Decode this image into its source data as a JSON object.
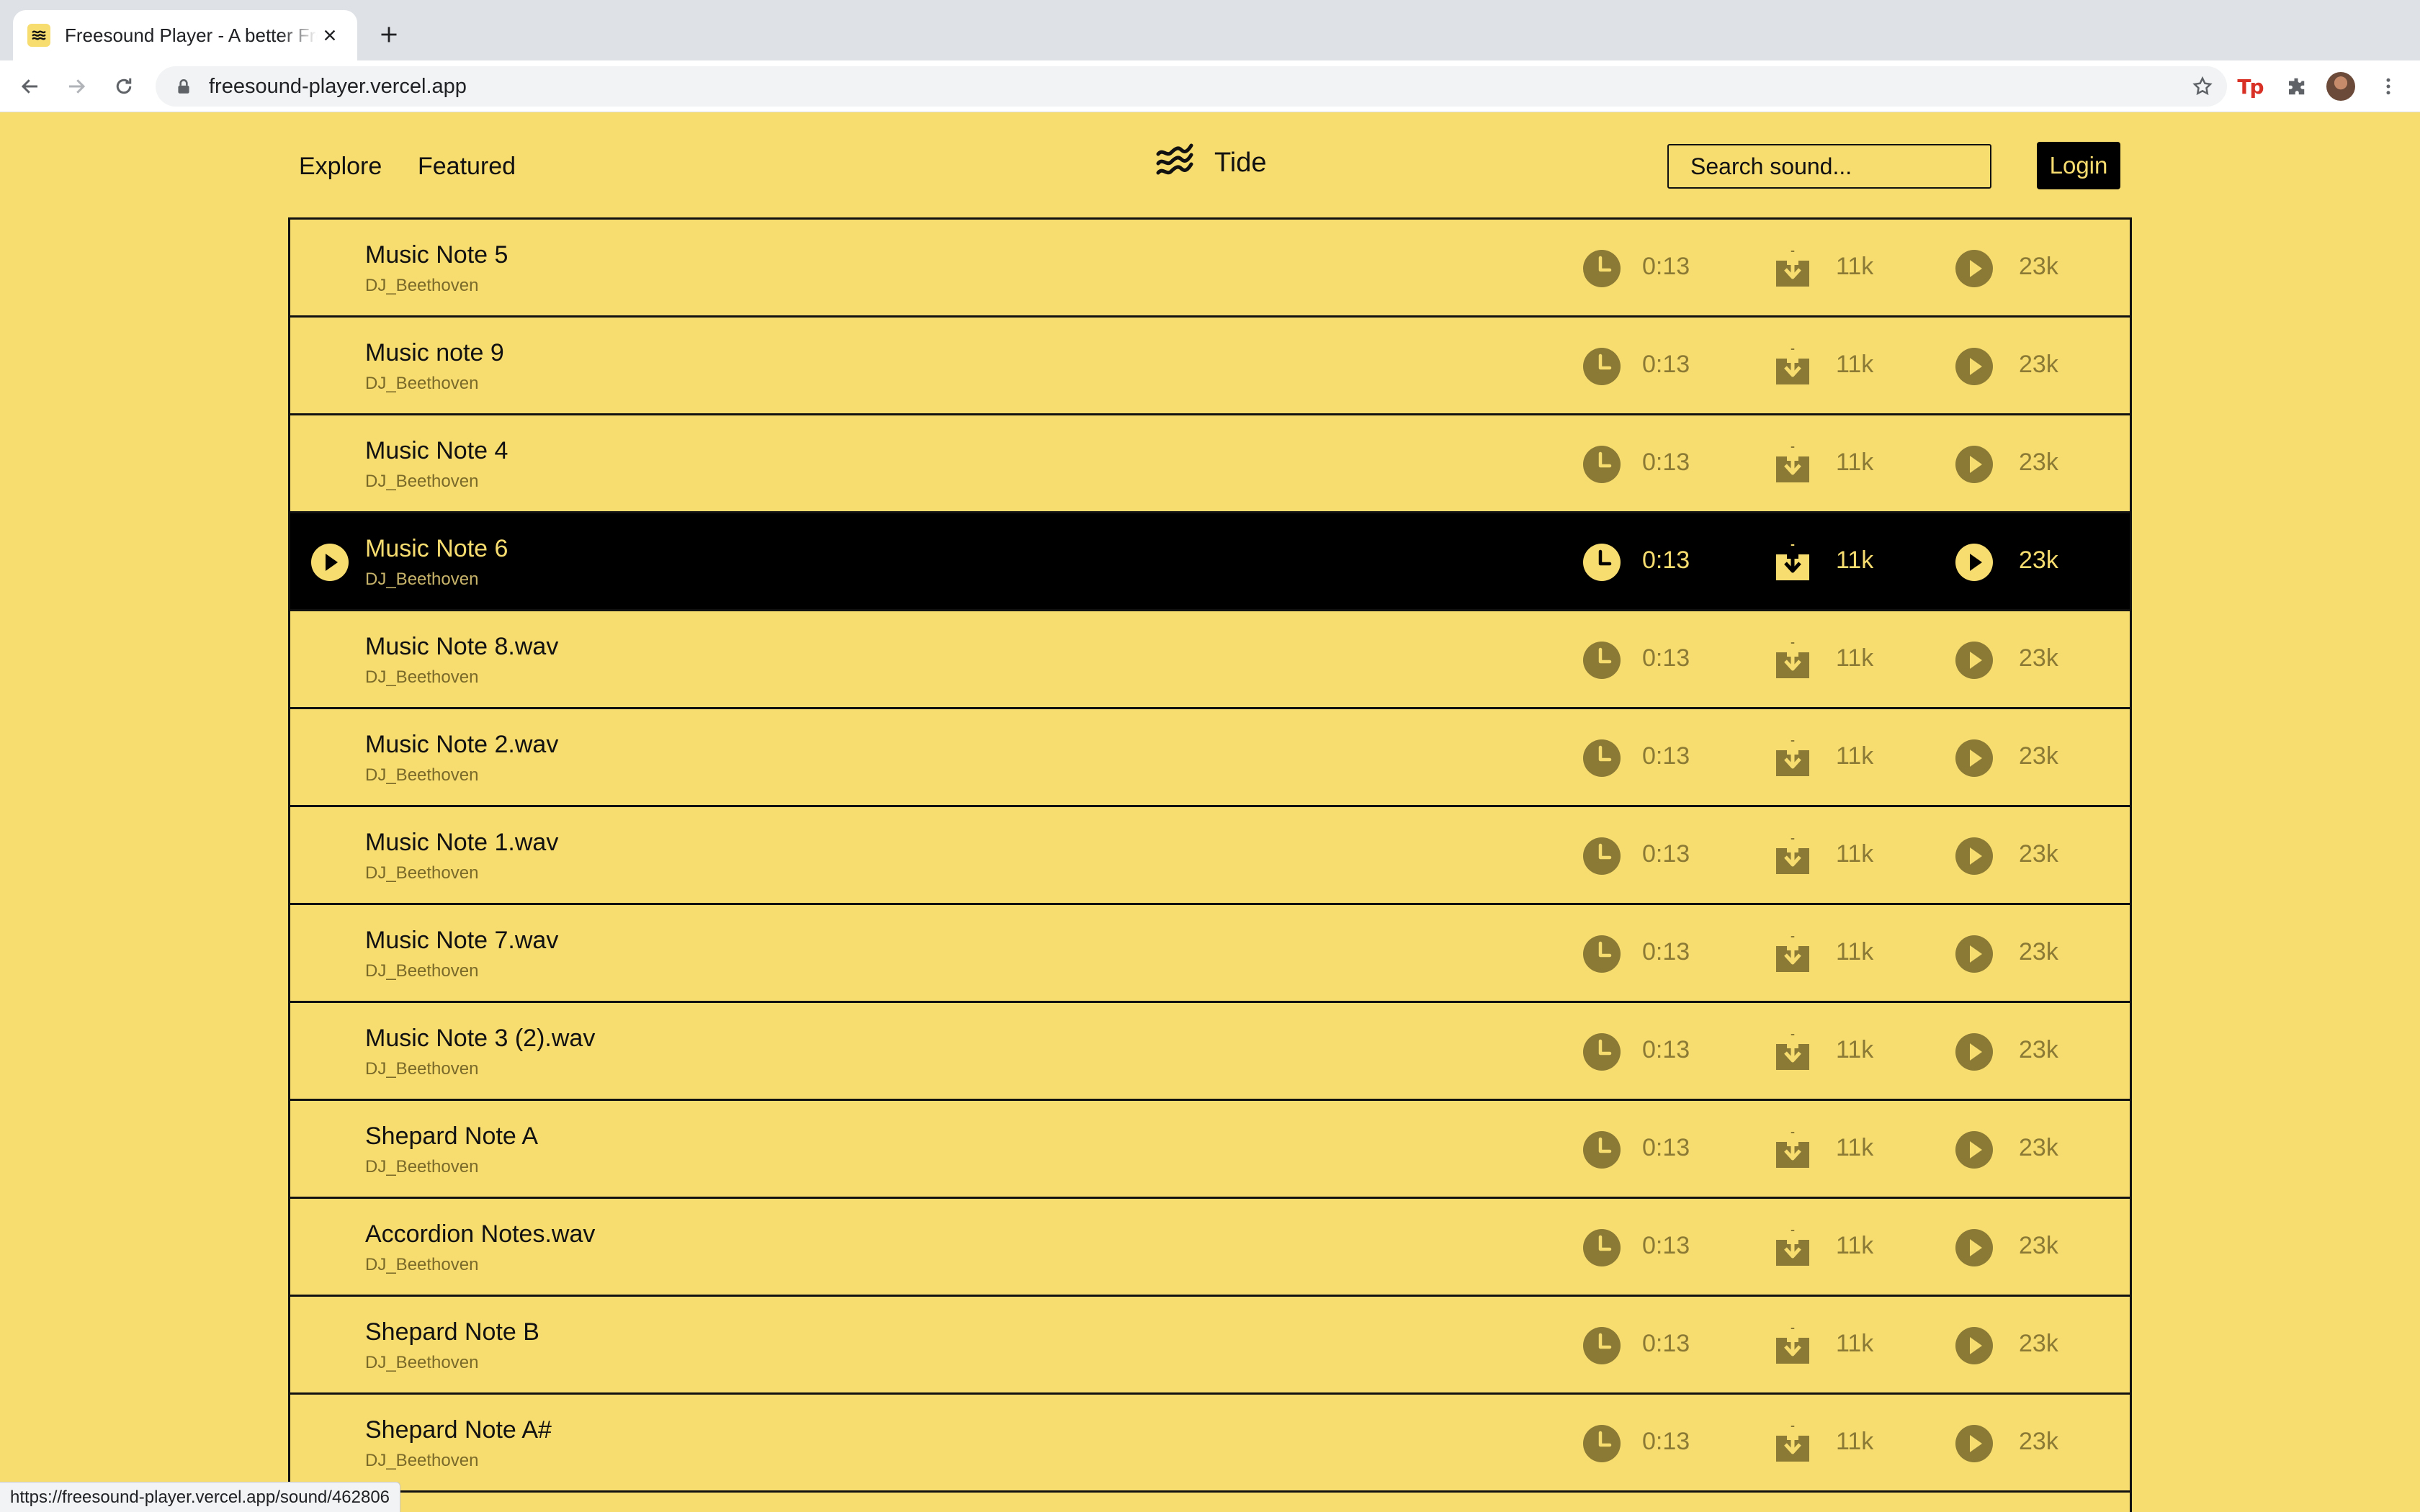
{
  "browser": {
    "tab_title": "Freesound Player - A better Freesound",
    "url": "freesound-player.vercel.app",
    "status_url": "https://freesound-player.vercel.app/sound/462806"
  },
  "header": {
    "nav": [
      "Explore",
      "Featured"
    ],
    "brand": "Tide",
    "search_placeholder": "Search sound...",
    "login_label": "Login"
  },
  "colors": {
    "background": "#f7dc6f",
    "ink": "#111111",
    "muted_icon": "#8a7a35",
    "active_row": "#000000"
  },
  "sounds": [
    {
      "name": "Music Note 5",
      "author": "DJ_Beethoven",
      "duration": "0:13",
      "downloads": "11k",
      "plays": "23k"
    },
    {
      "name": "Music note 9",
      "author": "DJ_Beethoven",
      "duration": "0:13",
      "downloads": "11k",
      "plays": "23k"
    },
    {
      "name": "Music Note 4",
      "author": "DJ_Beethoven",
      "duration": "0:13",
      "downloads": "11k",
      "plays": "23k"
    },
    {
      "name": "Music Note 6",
      "author": "DJ_Beethoven",
      "duration": "0:13",
      "downloads": "11k",
      "plays": "23k",
      "active": true
    },
    {
      "name": "Music Note 8.wav",
      "author": "DJ_Beethoven",
      "duration": "0:13",
      "downloads": "11k",
      "plays": "23k"
    },
    {
      "name": "Music Note 2.wav",
      "author": "DJ_Beethoven",
      "duration": "0:13",
      "downloads": "11k",
      "plays": "23k"
    },
    {
      "name": "Music Note 1.wav",
      "author": "DJ_Beethoven",
      "duration": "0:13",
      "downloads": "11k",
      "plays": "23k"
    },
    {
      "name": "Music Note 7.wav",
      "author": "DJ_Beethoven",
      "duration": "0:13",
      "downloads": "11k",
      "plays": "23k"
    },
    {
      "name": "Music Note 3 (2).wav",
      "author": "DJ_Beethoven",
      "duration": "0:13",
      "downloads": "11k",
      "plays": "23k"
    },
    {
      "name": "Shepard Note A",
      "author": "DJ_Beethoven",
      "duration": "0:13",
      "downloads": "11k",
      "plays": "23k"
    },
    {
      "name": "Accordion Notes.wav",
      "author": "DJ_Beethoven",
      "duration": "0:13",
      "downloads": "11k",
      "plays": "23k"
    },
    {
      "name": "Shepard Note B",
      "author": "DJ_Beethoven",
      "duration": "0:13",
      "downloads": "11k",
      "plays": "23k"
    },
    {
      "name": "Shepard Note A#",
      "author": "DJ_Beethoven",
      "duration": "0:13",
      "downloads": "11k",
      "plays": "23k"
    }
  ]
}
